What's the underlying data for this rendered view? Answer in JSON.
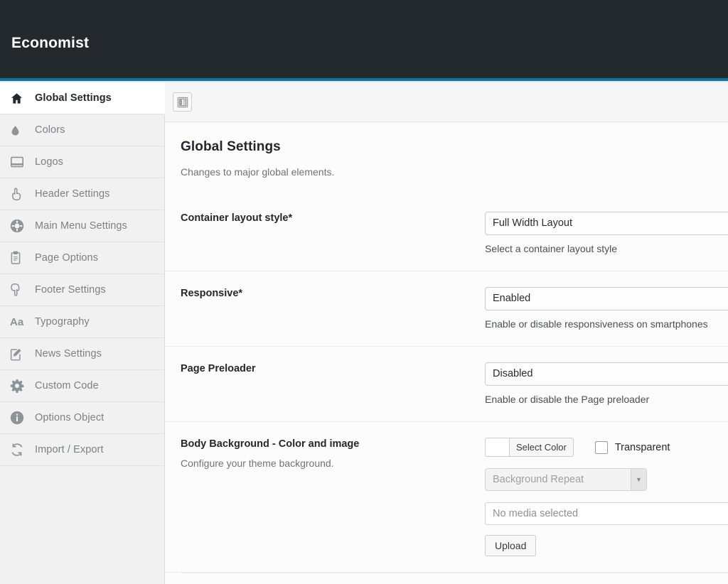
{
  "header": {
    "title": "Economist",
    "accent_color": "#1b6ea0",
    "background_color": "#23282d"
  },
  "sidebar": {
    "items": [
      {
        "label": "Global Settings",
        "icon": "home-icon",
        "active": true
      },
      {
        "label": "Colors",
        "icon": "droplet-icon",
        "active": false
      },
      {
        "label": "Logos",
        "icon": "display-icon",
        "active": false
      },
      {
        "label": "Header Settings",
        "icon": "hand-up-icon",
        "active": false
      },
      {
        "label": "Main Menu Settings",
        "icon": "gear-circle-icon",
        "active": false
      },
      {
        "label": "Page Options",
        "icon": "clipboard-icon",
        "active": false
      },
      {
        "label": "Footer Settings",
        "icon": "hand-down-icon",
        "active": false
      },
      {
        "label": "Typography",
        "icon": "aa-icon",
        "active": false
      },
      {
        "label": "News Settings",
        "icon": "pencil-page-icon",
        "active": false
      },
      {
        "label": "Custom Code",
        "icon": "gear-icon",
        "active": false
      },
      {
        "label": "Options Object",
        "icon": "info-icon",
        "active": false
      },
      {
        "label": "Import / Export",
        "icon": "refresh-icon",
        "active": false
      }
    ]
  },
  "toolbar": {
    "expand_button_icon": "panel-layout-icon"
  },
  "panel": {
    "title": "Global Settings",
    "subtitle": "Changes to major global elements."
  },
  "fields": {
    "container_layout": {
      "label": "Container layout style*",
      "value": "Full Width Layout",
      "help": "Select a container layout style"
    },
    "responsive": {
      "label": "Responsive*",
      "value": "Enabled",
      "help": "Enable or disable responsiveness on smartphones"
    },
    "page_preloader": {
      "label": "Page Preloader",
      "value": "Disabled",
      "help": "Enable or disable the Page preloader"
    },
    "body_background": {
      "label": "Body Background - Color and image",
      "sublabel": "Configure your theme background.",
      "select_color_button": "Select Color",
      "swatch_color": "#ffffff",
      "transparent_label": "Transparent",
      "transparent_checked": false,
      "repeat_placeholder": "Background Repeat",
      "repeat_arrow_glyph": "▼",
      "media_value": "No media selected",
      "upload_button": "Upload"
    }
  }
}
